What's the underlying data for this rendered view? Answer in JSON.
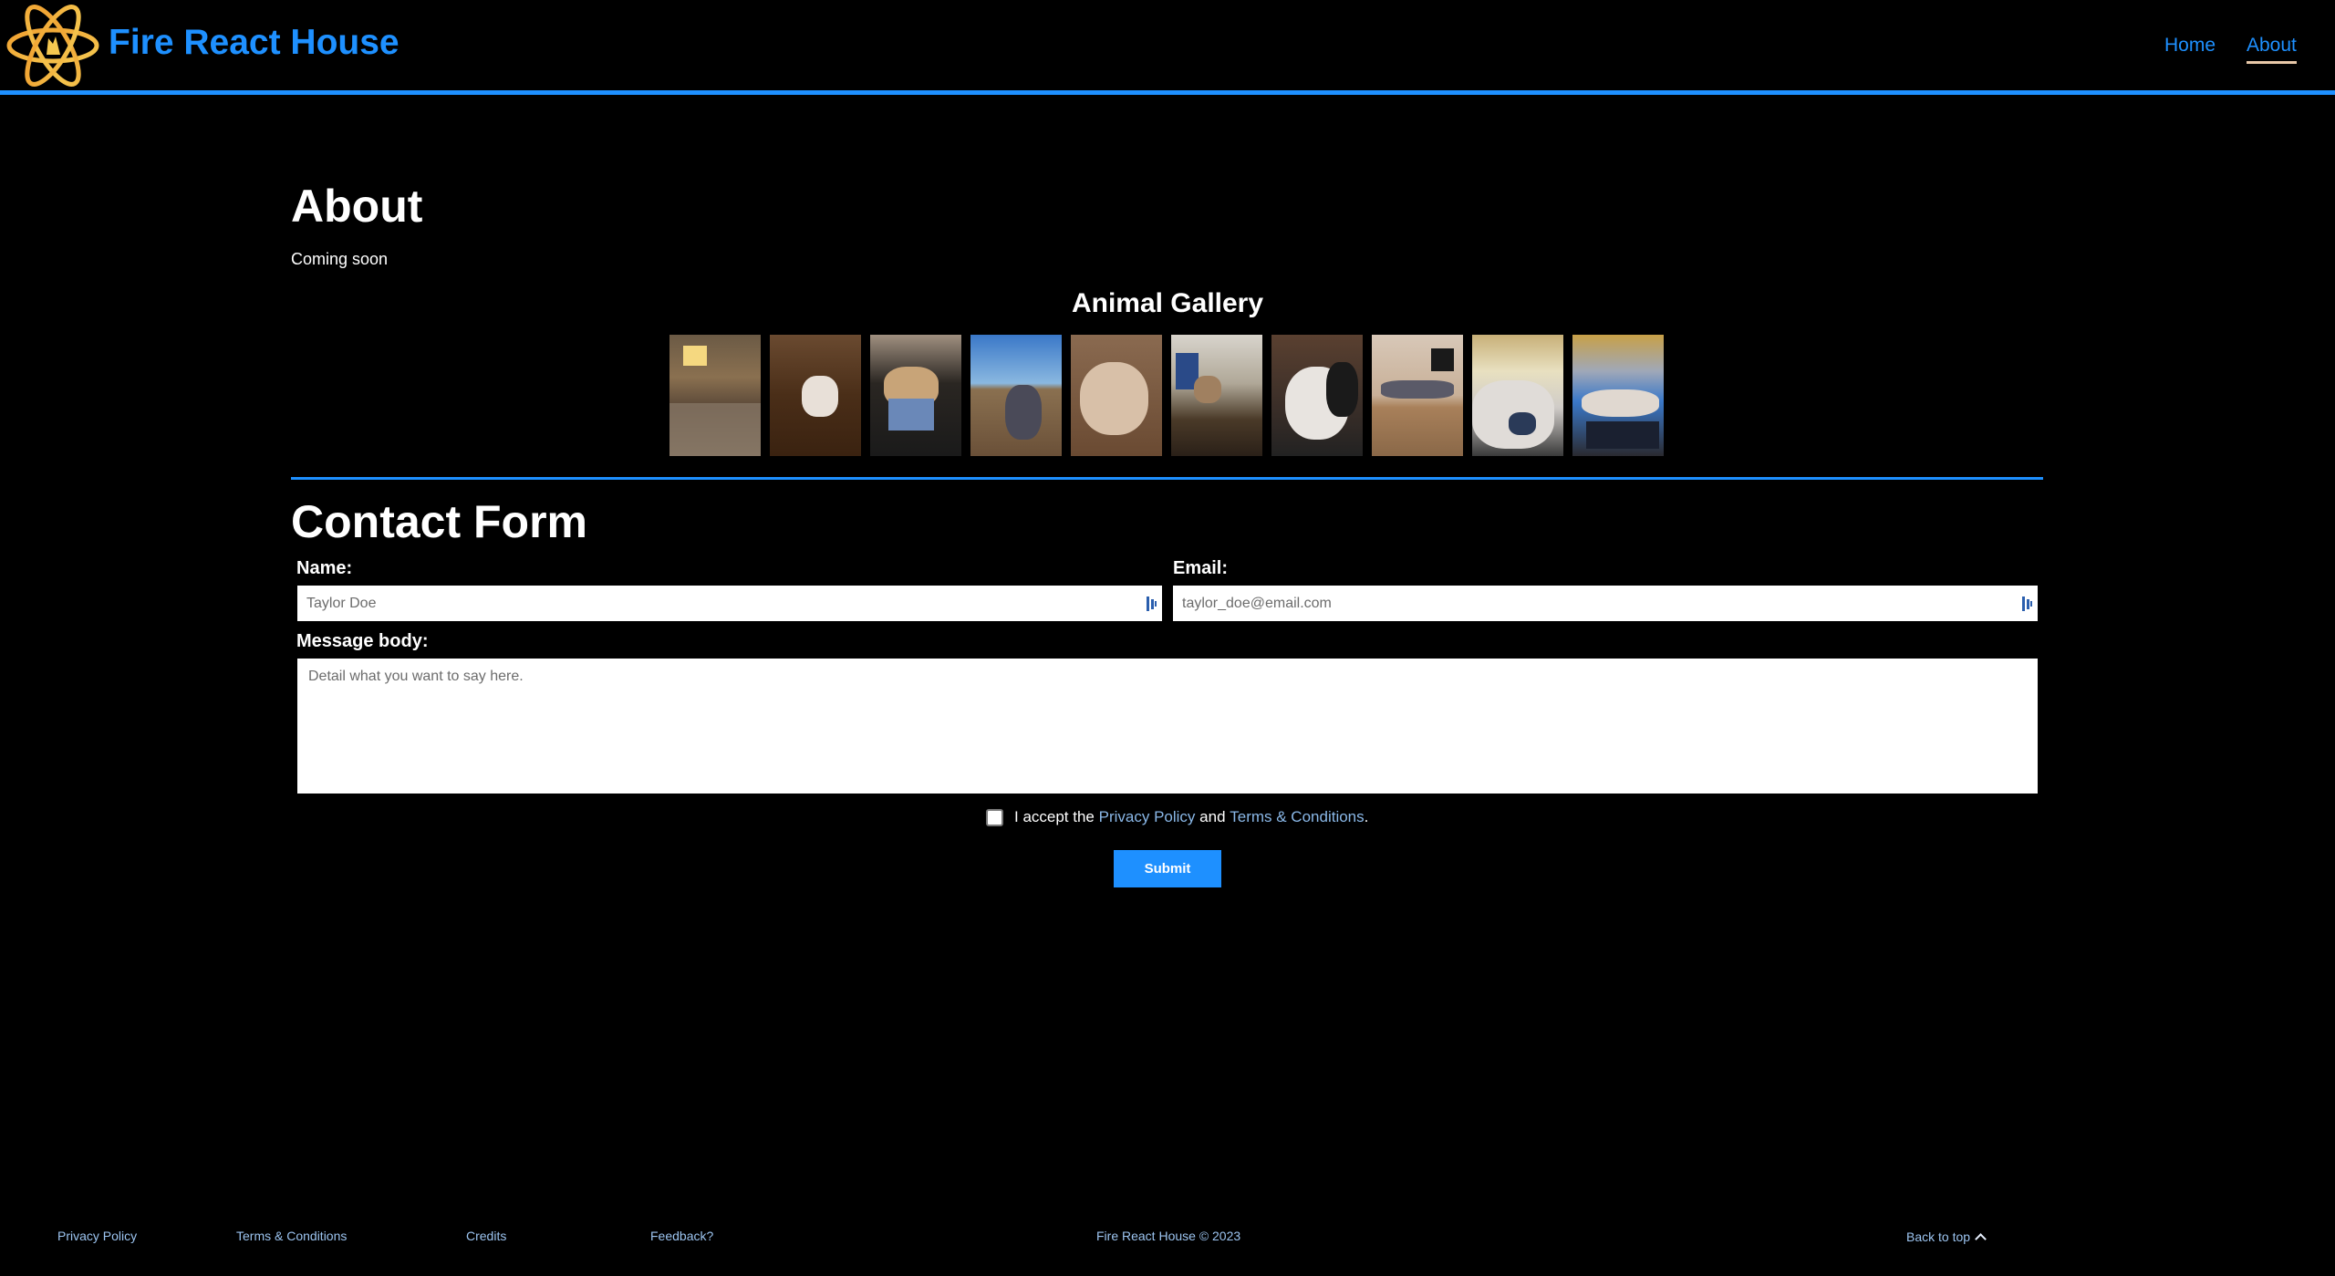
{
  "header": {
    "brand": "Fire React House",
    "logo_icon": "react-atom-firebase-flame-icon",
    "nav": [
      {
        "label": "Home",
        "active": false
      },
      {
        "label": "About",
        "active": true
      }
    ],
    "accent_color": "#1e90ff",
    "logo_color": "#f0a030"
  },
  "about": {
    "title": "About",
    "body": "Coming soon"
  },
  "gallery": {
    "title": "Animal Gallery",
    "photos": [
      {
        "alt": "Dog on couch in living room"
      },
      {
        "alt": "Cat on leather chair"
      },
      {
        "alt": "Siamese cat on blanket"
      },
      {
        "alt": "Dog in field under blue sky"
      },
      {
        "alt": "Cat close-up sleeping"
      },
      {
        "alt": "Siamese cat on wooden table"
      },
      {
        "alt": "Black and white cat curled up"
      },
      {
        "alt": "Dog with teddy bear on couch"
      },
      {
        "alt": "White cat sleeping on desk"
      },
      {
        "alt": "Cat lying on keyboard"
      }
    ]
  },
  "contact": {
    "title": "Contact Form",
    "name_label": "Name:",
    "name_placeholder": "Taylor Doe",
    "name_value": "",
    "email_label": "Email:",
    "email_placeholder": "taylor_doe@email.com",
    "email_value": "",
    "message_label": "Message body:",
    "message_placeholder": "Detail what you want to say here.",
    "message_value": "",
    "accept_prefix": "I accept the ",
    "accept_privacy": "Privacy Policy",
    "accept_and": " and ",
    "accept_terms": "Terms & Conditions",
    "accept_suffix": ".",
    "accept_checked": false,
    "submit_label": "Submit"
  },
  "footer": {
    "privacy": "Privacy Policy",
    "terms": "Terms & Conditions",
    "credits": "Credits",
    "feedback": "Feedback?",
    "copyright": "Fire React House © 2023",
    "back_to_top": "Back to top"
  }
}
